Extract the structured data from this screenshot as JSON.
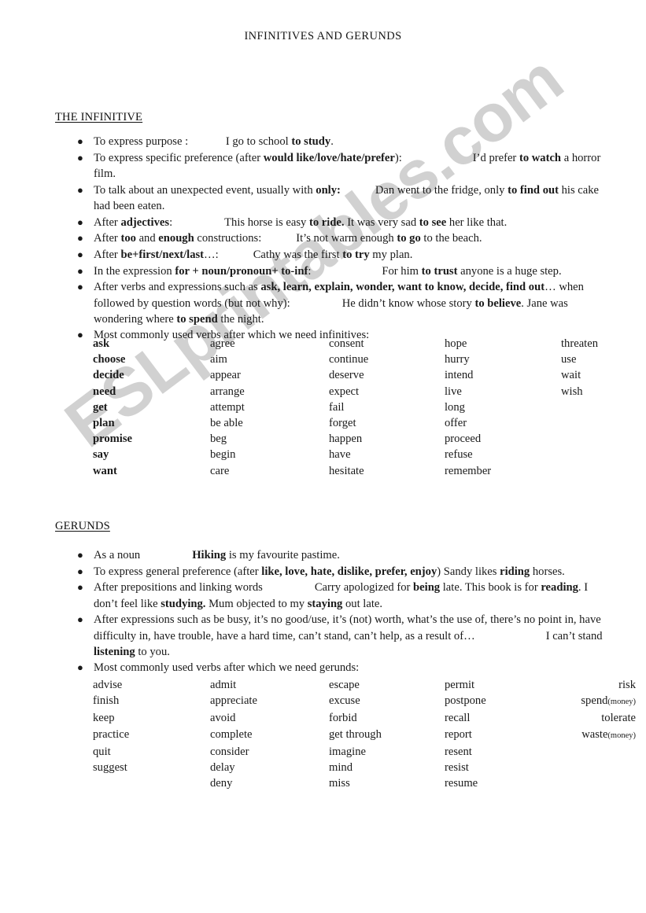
{
  "document": {
    "title": "INFINITIVES AND GERUNDS",
    "watermark": "ESLprintables.com",
    "watermark_color": "#c9c9c9",
    "page_background": "#ffffff",
    "text_color": "#1a1a1a"
  },
  "infinitive": {
    "heading": "THE INFINITIVE",
    "bullets": [
      {
        "id": "purpose",
        "parts": [
          {
            "t": "To express purpose : ",
            "b": false
          },
          {
            "t": "\t",
            "b": false,
            "tab": "md"
          },
          {
            "t": "I go to school ",
            "b": false
          },
          {
            "t": "to study",
            "b": true
          },
          {
            "t": ".",
            "b": false
          }
        ]
      },
      {
        "id": "specific-preference",
        "parts": [
          {
            "t": "To express specific preference (after ",
            "b": false
          },
          {
            "t": "would like/love/hate/prefer",
            "b": true
          },
          {
            "t": "):",
            "b": false
          },
          {
            "t": "\t",
            "b": false,
            "tab": "xl"
          },
          {
            "t": "I’d prefer ",
            "b": false
          },
          {
            "t": "to watch",
            "b": true
          },
          {
            "t": " a horror film.",
            "b": false
          }
        ]
      },
      {
        "id": "unexpected-event",
        "parts": [
          {
            "t": "To talk about an unexpected event, usually with ",
            "b": false
          },
          {
            "t": "only:",
            "b": true
          },
          {
            "t": "\t",
            "b": false,
            "tab": "md"
          },
          {
            "t": "Dan went to the fridge, only ",
            "b": false
          },
          {
            "t": "to find out",
            "b": true
          },
          {
            "t": " his cake had been eaten.",
            "b": false
          }
        ]
      },
      {
        "id": "after-adjectives",
        "parts": [
          {
            "t": "After ",
            "b": false
          },
          {
            "t": "adjectives",
            "b": true
          },
          {
            "t": ":",
            "b": false
          },
          {
            "t": "\t",
            "b": false,
            "tab": "lg"
          },
          {
            "t": "This horse is easy ",
            "b": false
          },
          {
            "t": "to ride.",
            "b": true
          },
          {
            "t": " It was very sad ",
            "b": false
          },
          {
            "t": "to see",
            "b": true
          },
          {
            "t": " her like that.",
            "b": false
          }
        ]
      },
      {
        "id": "too-enough",
        "parts": [
          {
            "t": "After ",
            "b": false
          },
          {
            "t": "too",
            "b": true
          },
          {
            "t": " and ",
            "b": false
          },
          {
            "t": "enough",
            "b": true
          },
          {
            "t": " constructions:",
            "b": false
          },
          {
            "t": "\t",
            "b": false,
            "tab": "md"
          },
          {
            "t": "It’s not warm enough ",
            "b": false
          },
          {
            "t": "to go",
            "b": true
          },
          {
            "t": " to the beach.",
            "b": false
          }
        ]
      },
      {
        "id": "be-first-next-last",
        "parts": [
          {
            "t": "After ",
            "b": false
          },
          {
            "t": "be+first/next/last",
            "b": true
          },
          {
            "t": "…:",
            "b": false
          },
          {
            "t": "\t",
            "b": false,
            "tab": "md"
          },
          {
            "t": "Cathy was the first ",
            "b": false
          },
          {
            "t": "to try",
            "b": true
          },
          {
            "t": " my plan.",
            "b": false
          }
        ]
      },
      {
        "id": "for-noun-pronoun",
        "parts": [
          {
            "t": "In the expression ",
            "b": false
          },
          {
            "t": "for + noun/pronoun+ to-inf",
            "b": true
          },
          {
            "t": ":",
            "b": false
          },
          {
            "t": "\t",
            "b": false,
            "tab": "xl"
          },
          {
            "t": "For him ",
            "b": false
          },
          {
            "t": "to trust",
            "b": true
          },
          {
            "t": " anyone is a huge step.",
            "b": false
          }
        ]
      },
      {
        "id": "verbs-question-words",
        "parts": [
          {
            "t": "After verbs and expressions such as ",
            "b": false
          },
          {
            "t": "ask, learn, explain, wonder, want to know, decide, find out",
            "b": true
          },
          {
            "t": "… when followed by question words (but not why):",
            "b": false
          },
          {
            "t": "\t",
            "b": false,
            "tab": "lg"
          },
          {
            "t": "He didn’t know whose story ",
            "b": false
          },
          {
            "t": "to believe",
            "b": true
          },
          {
            "t": ". Jane was wondering where ",
            "b": false
          },
          {
            "t": "to spend",
            "b": true
          },
          {
            "t": " the night.",
            "b": false
          }
        ]
      },
      {
        "id": "most-common-verbs",
        "parts": [
          {
            "t": "Most commonly used verbs after which we need infinitives:",
            "b": false
          }
        ]
      }
    ],
    "verb_table": {
      "columns": 5,
      "rows": [
        [
          "ask",
          "agree",
          "consent",
          "hope",
          "threaten"
        ],
        [
          "choose",
          "aim",
          "continue",
          "hurry",
          "use"
        ],
        [
          "decide",
          "appear",
          "deserve",
          "intend",
          "wait"
        ],
        [
          "need",
          "arrange",
          "expect",
          "live",
          "wish"
        ],
        [
          "get",
          "attempt",
          "fail",
          "long",
          ""
        ],
        [
          "plan",
          "be able",
          "forget",
          "offer",
          ""
        ],
        [
          "promise",
          "beg",
          "happen",
          "proceed",
          ""
        ],
        [
          "say",
          "begin",
          "have",
          "refuse",
          ""
        ],
        [
          "want",
          "care",
          "hesitate",
          "remember",
          ""
        ]
      ]
    }
  },
  "gerunds": {
    "heading": "GERUNDS",
    "bullets": [
      {
        "id": "as-a-noun",
        "parts": [
          {
            "t": "As a noun",
            "b": false
          },
          {
            "t": "\t",
            "b": false,
            "tab": "lg"
          },
          {
            "t": "Hiking",
            "b": true
          },
          {
            "t": " is my favourite pastime.",
            "b": false
          }
        ]
      },
      {
        "id": "general-preference",
        "parts": [
          {
            "t": "To express general preference (after ",
            "b": false
          },
          {
            "t": "like, love, hate, dislike, prefer, enjoy",
            "b": true
          },
          {
            "t": ") Sandy likes ",
            "b": false
          },
          {
            "t": "riding",
            "b": true
          },
          {
            "t": " horses.",
            "b": false
          }
        ]
      },
      {
        "id": "after-prepositions",
        "parts": [
          {
            "t": "After prepositions and linking words",
            "b": false
          },
          {
            "t": "\t",
            "b": false,
            "tab": "lg"
          },
          {
            "t": "Carry apologized for ",
            "b": false
          },
          {
            "t": "being",
            "b": true
          },
          {
            "t": " late. This book is for ",
            "b": false
          },
          {
            "t": "reading",
            "b": true
          },
          {
            "t": ". I don’t feel like ",
            "b": false
          },
          {
            "t": "studying.",
            "b": true
          },
          {
            "t": " Mum objected to my ",
            "b": false
          },
          {
            "t": "staying",
            "b": true
          },
          {
            "t": " out late.",
            "b": false
          }
        ]
      },
      {
        "id": "after-expressions",
        "parts": [
          {
            "t": "After expressions such as be busy, it’s no good/use, it’s (not) worth, what’s the use of, there’s no point in, have difficulty in, have trouble, have a hard time, can’t stand, can’t help, as a result of…",
            "b": false
          },
          {
            "t": "\t",
            "b": false,
            "tab": "xl"
          },
          {
            "t": "I can’t stand ",
            "b": false
          },
          {
            "t": "listening",
            "b": true
          },
          {
            "t": " to you.",
            "b": false
          }
        ]
      },
      {
        "id": "most-common-verbs",
        "parts": [
          {
            "t": "Most commonly used verbs after which we need gerunds:",
            "b": false
          }
        ]
      }
    ],
    "verb_table": {
      "columns": 5,
      "rows": [
        [
          "advise",
          "admit",
          "escape",
          "permit",
          "risk"
        ],
        [
          "finish",
          "appreciate",
          "excuse",
          "postpone",
          "spend(money)"
        ],
        [
          "keep",
          "avoid",
          "forbid",
          "recall",
          "tolerate"
        ],
        [
          "practice",
          "complete",
          "get through",
          "report",
          "waste(money)"
        ],
        [
          "quit",
          "consider",
          "imagine",
          "resent",
          ""
        ],
        [
          "suggest",
          "delay",
          "mind",
          "resist",
          ""
        ],
        [
          "",
          "deny",
          "miss",
          "resume",
          ""
        ]
      ]
    }
  }
}
